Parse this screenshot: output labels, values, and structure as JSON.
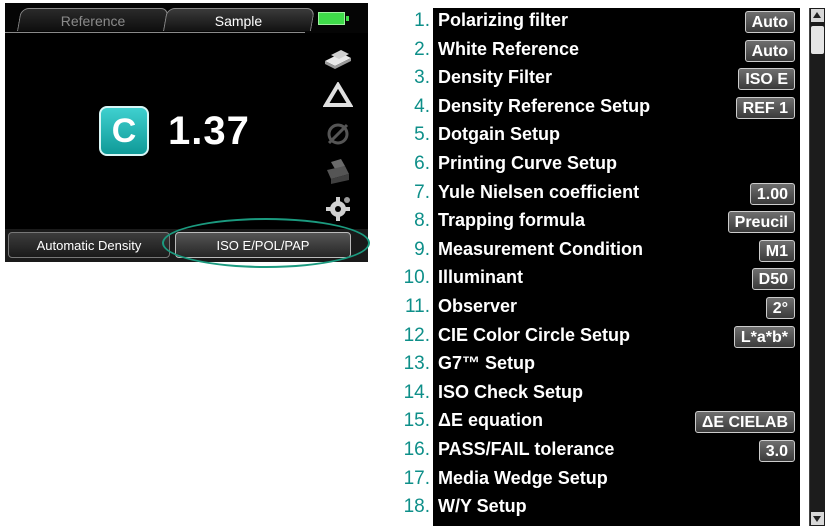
{
  "device": {
    "tabs": [
      {
        "label": "Reference",
        "active": false
      },
      {
        "label": "Sample",
        "active": true
      }
    ],
    "battery": {
      "icon": "battery-full-icon",
      "color": "#3fdc4a"
    },
    "side_icons": [
      "paper-stack-icon",
      "triangle-icon",
      "null-circle-icon",
      "printer-icon",
      "gear-icon"
    ],
    "channel_badge": "C",
    "channel_color": "#1fb3b1",
    "density_value": "1.37",
    "bottom_buttons": {
      "automatic": "Automatic Density",
      "settings": "ISO E/POL/PAP"
    },
    "highlight_color": "#1b9a7f"
  },
  "menu": {
    "number_color": "#0e8f89",
    "items": [
      {
        "num": "1.",
        "label": "Polarizing filter",
        "value": "Auto"
      },
      {
        "num": "2.",
        "label": "White Reference",
        "value": "Auto"
      },
      {
        "num": "3.",
        "label": "Density Filter",
        "value": "ISO E"
      },
      {
        "num": "4.",
        "label": "Density Reference Setup",
        "value": "REF 1"
      },
      {
        "num": "5.",
        "label": "Dotgain Setup",
        "value": ""
      },
      {
        "num": "6.",
        "label": "Printing Curve Setup",
        "value": ""
      },
      {
        "num": "7.",
        "label": "Yule Nielsen coefficient",
        "value": "1.00"
      },
      {
        "num": "8.",
        "label": "Trapping formula",
        "value": "Preucil"
      },
      {
        "num": "9.",
        "label": "Measurement Condition",
        "value": "M1"
      },
      {
        "num": "10.",
        "label": "Illuminant",
        "value": "D50"
      },
      {
        "num": "11.",
        "label": "Observer",
        "value": "2°"
      },
      {
        "num": "12.",
        "label": "CIE Color Circle Setup",
        "value": "L*a*b*"
      },
      {
        "num": "13.",
        "label": "G7™ Setup",
        "value": ""
      },
      {
        "num": "14.",
        "label": "ISO Check Setup",
        "value": ""
      },
      {
        "num": "15.",
        "label": "ΔE equation",
        "value": "ΔE CIELAB"
      },
      {
        "num": "16.",
        "label": "PASS/FAIL tolerance",
        "value": "3.0"
      },
      {
        "num": "17.",
        "label": "Media Wedge Setup",
        "value": ""
      },
      {
        "num": "18.",
        "label": "W/Y Setup",
        "value": ""
      }
    ]
  }
}
